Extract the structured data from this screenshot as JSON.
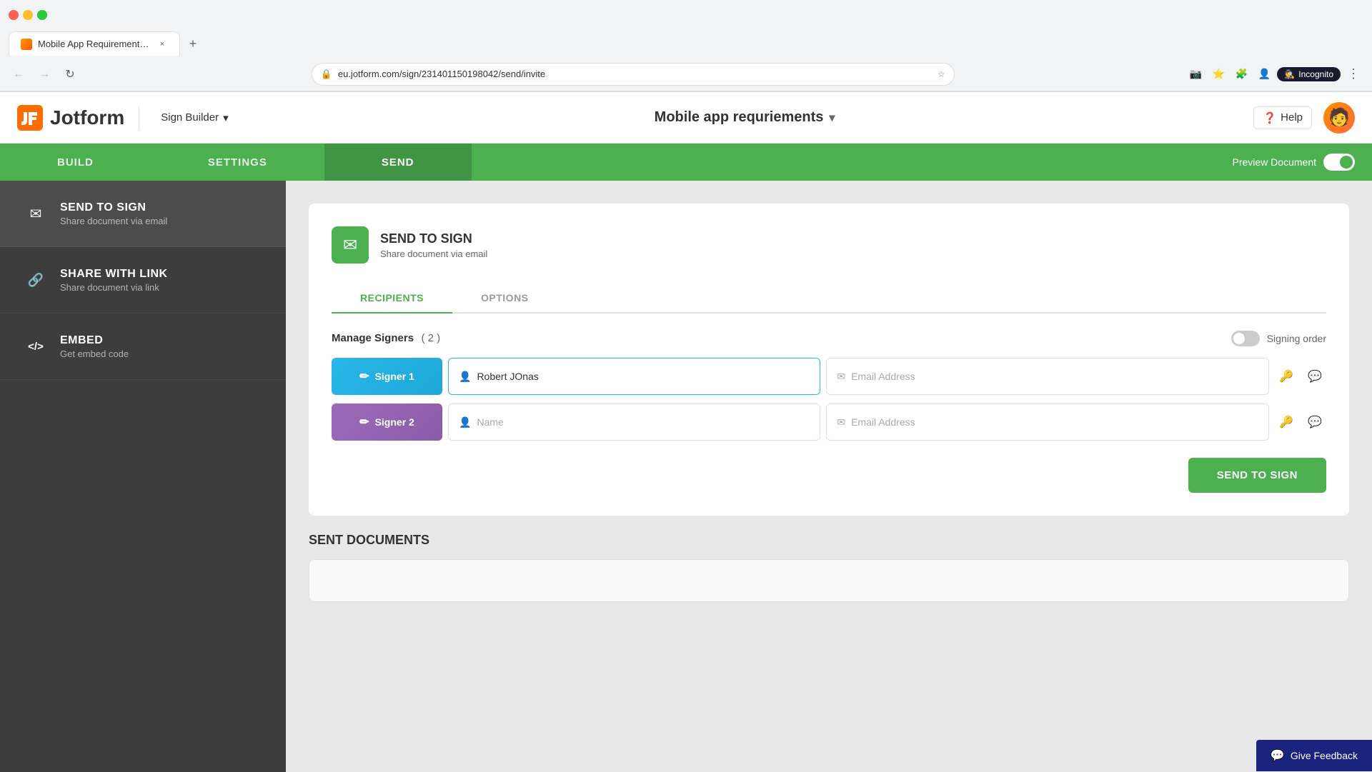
{
  "browser": {
    "tab_title": "Mobile App Requirements - Cop",
    "url": "eu.jotform.com/sign/231401150198042/send/invite",
    "incognito_label": "Incognito"
  },
  "header": {
    "logo_text": "Jotform",
    "sign_builder_label": "Sign Builder",
    "doc_title": "Mobile app requriements",
    "help_label": "Help"
  },
  "nav_tabs": [
    {
      "id": "build",
      "label": "BUILD"
    },
    {
      "id": "settings",
      "label": "SETTINGS"
    },
    {
      "id": "send",
      "label": "SEND"
    }
  ],
  "active_tab": "send",
  "preview_label": "Preview Document",
  "sidebar": {
    "items": [
      {
        "id": "send-to-sign",
        "icon": "✉",
        "title": "SEND TO SIGN",
        "subtitle": "Share document via email",
        "active": true
      },
      {
        "id": "share-with-link",
        "icon": "🔗",
        "title": "SHARE WITH LINK",
        "subtitle": "Share document via link",
        "active": false
      },
      {
        "id": "embed",
        "icon": "</>",
        "title": "EMBED",
        "subtitle": "Get embed code",
        "active": false
      }
    ]
  },
  "panel": {
    "icon": "✉",
    "title": "SEND TO SIGN",
    "subtitle": "Share document via email"
  },
  "tabs": [
    {
      "id": "recipients",
      "label": "RECIPIENTS",
      "active": true
    },
    {
      "id": "options",
      "label": "OPTIONS",
      "active": false
    }
  ],
  "signers_section": {
    "title": "Manage Signers",
    "count": "( 2 )",
    "signing_order_label": "Signing order"
  },
  "signers": [
    {
      "id": "signer1",
      "label": "Signer 1",
      "name_value": "Robert JOnas",
      "name_placeholder": "Name",
      "email_placeholder": "Email Address",
      "style": "signer1"
    },
    {
      "id": "signer2",
      "label": "Signer 2",
      "name_value": "",
      "name_placeholder": "Name",
      "email_placeholder": "Email Address",
      "style": "signer2"
    }
  ],
  "send_button_label": "SEND TO SIGN",
  "sent_docs_title": "SENT DOCUMENTS",
  "give_feedback_label": "Give Feedback"
}
